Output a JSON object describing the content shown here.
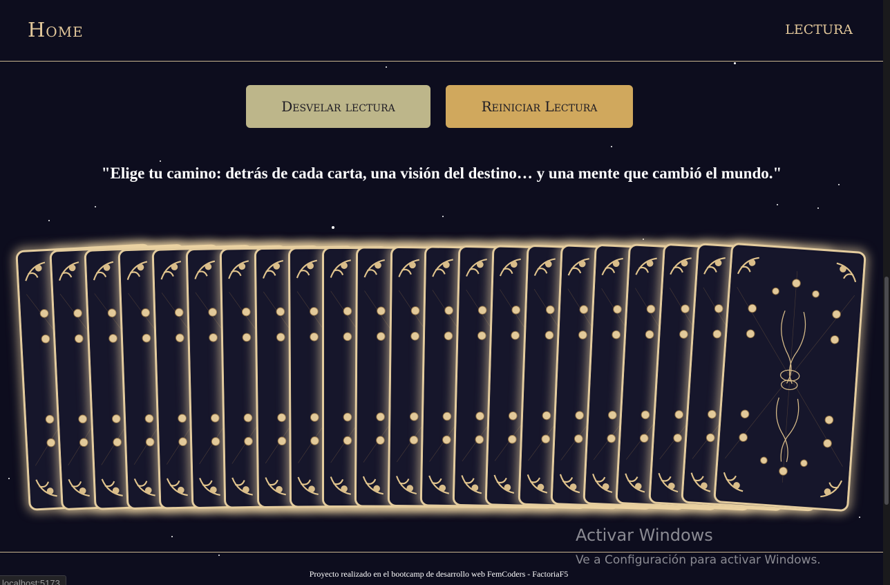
{
  "header": {
    "home_label": "Home",
    "lectura_label": "LECTURA"
  },
  "actions": {
    "desvelar_label": "Desvelar lectura",
    "reiniciar_label": "Reiniciar Lectura"
  },
  "quote": "\"Elige tu camino: detrás de cada carta, una visión del destino… y una mente que cambió el mundo.\"",
  "deck": {
    "card_count": 22,
    "card_face": "card-back-moon-pattern"
  },
  "footer": {
    "credit": "Proyecto realizado en el bootcamp de desarrollo web FemCoders - FactoriaF5"
  },
  "status_bar": {
    "url": "localhost:5173"
  },
  "windows_watermark": {
    "title": "Activar Windows",
    "subtitle": "Ve a Configuración para activar Windows."
  },
  "colors": {
    "background": "#0d0d1e",
    "gold": "#e2c79a",
    "button_desvelar": "#bdb68a",
    "button_reiniciar": "#d0a85d",
    "card_border": "#e4cc9e"
  }
}
